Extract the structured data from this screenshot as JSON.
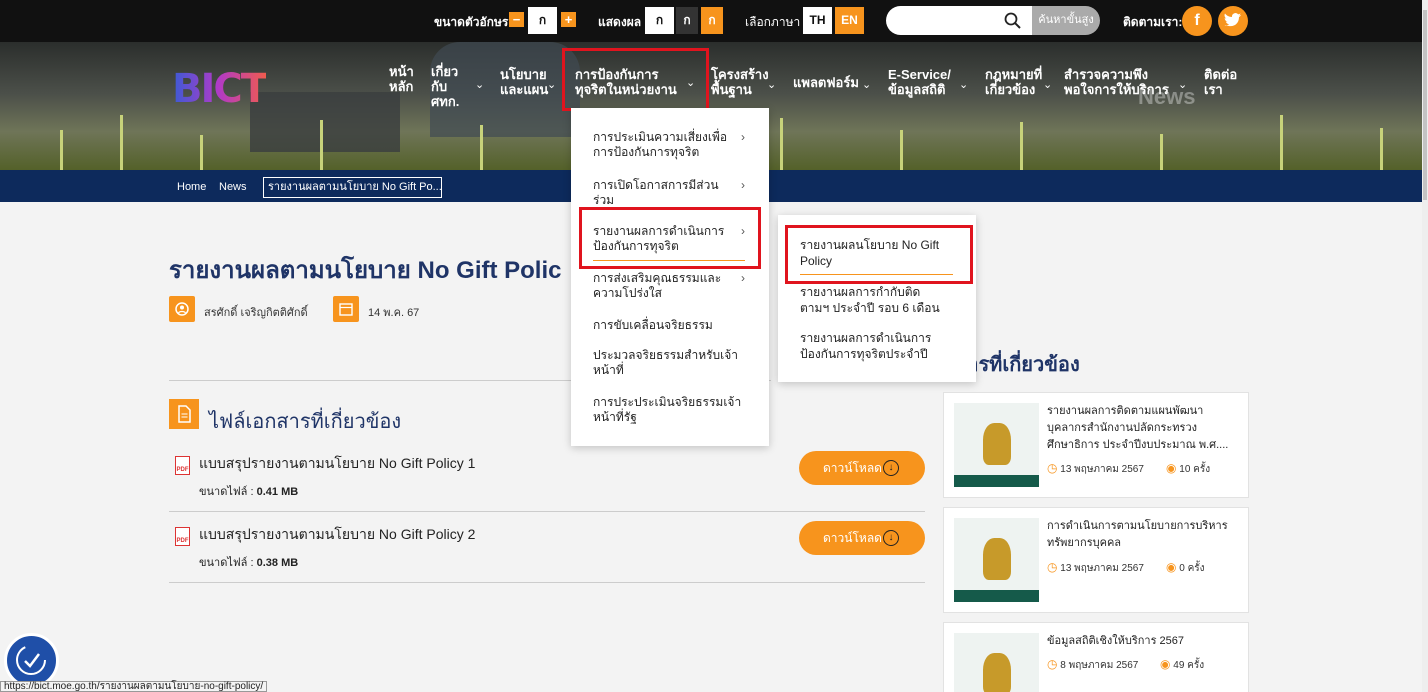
{
  "topbar": {
    "font_size_label": "ขนาดตัวอักษร",
    "font_minus": "−",
    "font_sample": "ก",
    "font_plus": "+",
    "display_label": "แสดงผล",
    "display_options": [
      "ก",
      "ก",
      "ก"
    ],
    "language_label": "เลือกภาษา",
    "lang_th": "TH",
    "lang_en": "EN",
    "search_placeholder": "",
    "advanced_search": "ค้นหาขั้นสูง",
    "follow_label": "ติดตามเรา:",
    "accent_color": "#f7941d"
  },
  "brand": {
    "logo_text": "BICT"
  },
  "nav": {
    "items": [
      {
        "label": "หน้า\nหลัก"
      },
      {
        "label": "เกี่ยว\nกับ\nศทก."
      },
      {
        "label": "นโยบาย\nและแผน"
      },
      {
        "label": "การป้องกันการ\nทุจริตในหน่วยงาน"
      },
      {
        "label": "โครงสร้าง\nพื้นฐาน"
      },
      {
        "label": "แพลตฟอร์ม"
      },
      {
        "label": "E-Service/\nข้อมูลสถิติ"
      },
      {
        "label": "กฎหมายที่\nเกี่ยวข้อง"
      },
      {
        "label": "สำรวจความพึง\nพอใจการให้บริการ"
      },
      {
        "label": "ติดต่อ\nเรา"
      }
    ],
    "hero_watermark": "News"
  },
  "breadcrumb": {
    "home": "Home",
    "news": "News",
    "current": "รายงานผลตามนโยบาย No Gift Po..."
  },
  "article": {
    "title": "รายงานผลตามนโยบาย No Gift Polic",
    "author": "สรศักดิ์ เจริญกิตติศักดิ์",
    "date": "14 พ.ค. 67",
    "files_heading": "ไฟล์เอกสารที่เกี่ยวข้อง",
    "files": [
      {
        "title": "แบบสรุปรายงานตามนโยบาย No Gift Policy 1",
        "size_label": "ขนาดไฟล์ :",
        "size": "0.41 MB",
        "download": "ดาวน์โหลด"
      },
      {
        "title": "แบบสรุปรายงานตามนโยบาย No Gift Policy 2",
        "size_label": "ขนาดไฟล์ :",
        "size": "0.38 MB",
        "download": "ดาวน์โหลด"
      }
    ]
  },
  "related": {
    "heading": "สารที่เกี่ยวข้อง",
    "cards": [
      {
        "title": "รายงานผลการติดตามแผนพัฒนาบุคลากรสำนักงานปลัดกระทรวงศึกษาธิการ ประจำปีงบประมาณ พ.ศ....",
        "date": "13 พฤษภาคม 2567",
        "views": "10 ครั้ง"
      },
      {
        "title": "การดำเนินการตามนโยบายการบริหารทรัพยากรบุคคล",
        "date": "13 พฤษภาคม 2567",
        "views": "0 ครั้ง"
      },
      {
        "title": "ข้อมูลสถิติเชิงให้บริการ 2567",
        "date": "8 พฤษภาคม 2567",
        "views": "49 ครั้ง"
      }
    ]
  },
  "dropdown": {
    "level1": [
      "การประเมินความเสี่ยงเพื่อ\nการป้องกันการทุจริต",
      "การเปิดโอกาสการมีส่วน\nร่วม",
      "รายงานผลการดำเนินการ\nป้องกันการทุจริต",
      "การส่งเสริมคุณธรรมและ\nความโปร่งใส",
      "การขับเคลื่อนจริยธรรม",
      "ประมวลจริยธรรมสำหรับเจ้า\nหน้าที่",
      "การประประเมินจริยธรรมเจ้า\nหน้าที่รัฐ"
    ],
    "level2": [
      "รายงานผลนโยบาย No Gift\nPolicy",
      "รายงานผลการกำกับติด\nตามฯ ประจำปี รอบ 6 เดือน",
      "รายงานผลการดำเนินการ\nป้องกันการทุจริตประจำปี"
    ]
  },
  "status_bar": {
    "url": "https://bict.moe.go.th/รายงานผลตามนโยบาย-no-gift-policy/"
  }
}
